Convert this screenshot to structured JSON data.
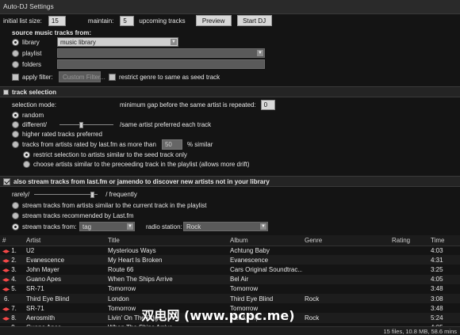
{
  "window": {
    "title": "Auto-DJ Settings"
  },
  "top": {
    "initial_label": "initial list size:",
    "initial_value": "15",
    "maintain_label": "maintain:",
    "maintain_value": "5",
    "upcoming_label": "upcoming tracks",
    "preview_label": "Preview",
    "start_label": "Start DJ"
  },
  "source": {
    "heading": "source music tracks from:",
    "library_label": "library",
    "library_value": "music library",
    "playlist_label": "playlist",
    "folders_label": "folders",
    "apply_filter_label": "apply filter:",
    "custom_filter_label": "Custom Filter...",
    "restrict_genre_label": "restrict genre to same as seed track"
  },
  "track_selection": {
    "heading": "track selection",
    "mode_label": "selection mode:",
    "gap_label": "minimum gap before the same artist is repeated:",
    "gap_value": "0",
    "random_label": "random",
    "different_label": "different/",
    "different_slider": 0.4,
    "same_artist_label": "/same artist preferred each track",
    "higher_rated_label": "higher rated tracks preferred",
    "lastfm_rated_label": "tracks from artists rated by last.fm as more than",
    "similar_value": "50",
    "similar_label": "% similar",
    "restrict_similar_label": "restrict selection to artists similar to the seed track only",
    "choose_similar_label": "choose artists similar to the preceeding track in the playlist (allows more drift)"
  },
  "stream": {
    "heading": "also stream tracks from last.fm or jamendo to discover new artists not in your library",
    "rarely_label": "rarely/",
    "freq_slider": 0.95,
    "frequently_label": "/ frequently",
    "similar_current_label": "stream tracks from artists similar to the current track in the playlist",
    "recommended_label": "stream tracks recommended by Last.fm",
    "from_label": "stream tracks from:",
    "from_value": "tag",
    "radio_station_label": "radio station:",
    "radio_station_value": "Rock"
  },
  "table": {
    "columns": [
      "#",
      "Artist",
      "Title",
      "Album",
      "Genre",
      "Rating",
      "Time"
    ],
    "rows": [
      {
        "num": "1.",
        "artist": "U2",
        "title": "Mysterious Ways",
        "album": "Achtung Baby",
        "genre": "",
        "time": "4:03",
        "flag": true
      },
      {
        "num": "2.",
        "artist": "Evanescence",
        "title": "My Heart Is Broken",
        "album": "Evanescence",
        "genre": "",
        "time": "4:31",
        "flag": true
      },
      {
        "num": "3.",
        "artist": "John Mayer",
        "title": "Route 66",
        "album": "Cars Original Soundtrac...",
        "genre": "",
        "time": "3:25",
        "flag": true
      },
      {
        "num": "4.",
        "artist": "Guano Apes",
        "title": "When The Ships Arrive",
        "album": "Bel Air",
        "genre": "",
        "time": "4:05",
        "flag": true
      },
      {
        "num": "5.",
        "artist": "SR-71",
        "title": "Tomorrow",
        "album": "Tomorrow",
        "genre": "",
        "time": "3:48",
        "flag": true
      },
      {
        "num": "6.",
        "artist": "Third Eye Blind",
        "title": "London",
        "album": "Third Eye Blind",
        "genre": "Rock",
        "time": "3:08",
        "flag": false
      },
      {
        "num": "7.",
        "artist": "SR-71",
        "title": "Tomorrow",
        "album": "Tomorrow",
        "genre": "",
        "time": "3:48",
        "flag": true
      },
      {
        "num": "8.",
        "artist": "Aerosmith",
        "title": "Livin' On The Edge",
        "album": "Get A Grip",
        "genre": "Rock",
        "time": "5:24",
        "flag": true
      },
      {
        "num": "9.",
        "artist": "Guano Apes",
        "title": "When The Ships Arrive",
        "album": "",
        "genre": "",
        "time": "4:05",
        "flag": true
      }
    ]
  },
  "status": {
    "text": "15 files, 10.8 MB, 58.6 mins"
  },
  "watermark": {
    "text": "双电网 (www.pcpc.me)"
  },
  "colors": {
    "background": "#141414",
    "flag": "#ff4a4a"
  }
}
